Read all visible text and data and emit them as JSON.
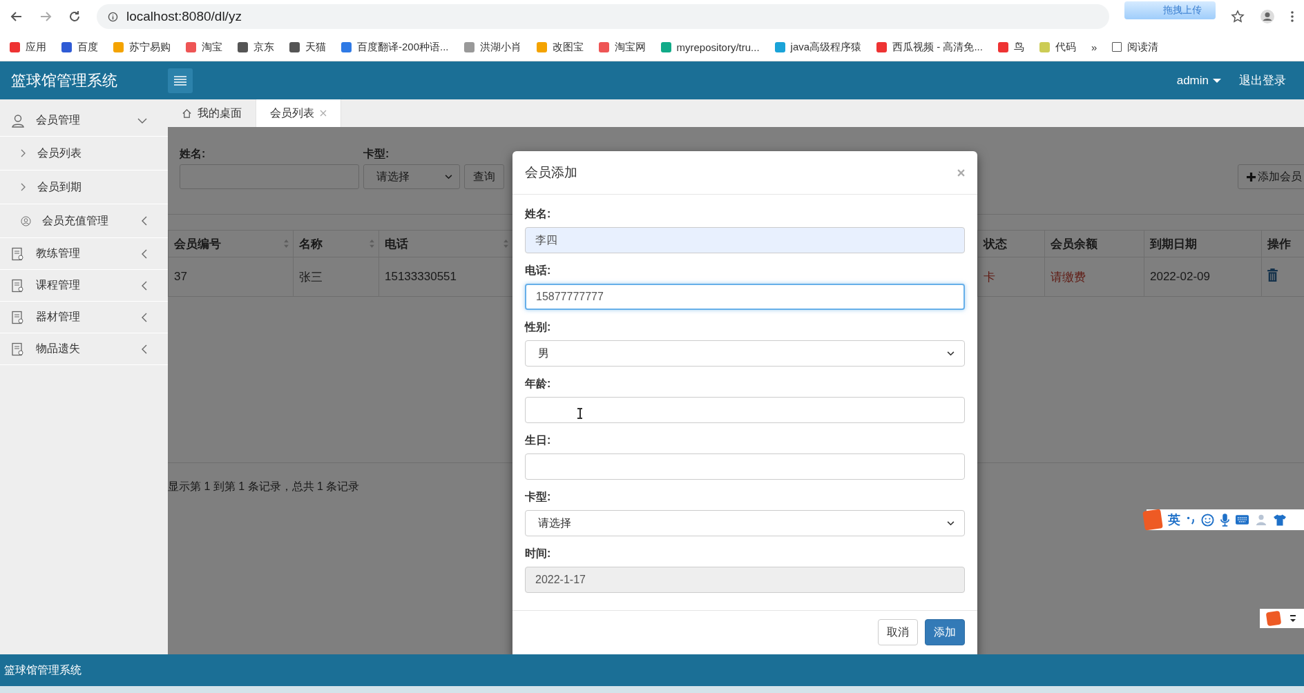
{
  "browser": {
    "url": "localhost:8080/dl/yz",
    "upload_widget": "拖拽上传",
    "bookmarks": [
      "应用",
      "百度",
      "苏宁易购",
      "淘宝",
      "京东",
      "天猫",
      "百度翻译-200种语...",
      "洪湖小肖",
      "改图宝",
      "淘宝网",
      "myrepository/tru...",
      "java高级程序猿",
      "西瓜视频 - 高清免...",
      "鸟",
      "代码"
    ],
    "more": "»",
    "reading_list": "阅读清"
  },
  "app": {
    "title": "篮球馆管理系统",
    "user": "admin",
    "logout": "退出登录"
  },
  "sidebar": {
    "items": [
      {
        "label": "会员管理",
        "expanded": true,
        "children": [
          {
            "label": "会员列表",
            "kind": "link"
          },
          {
            "label": "会员到期",
            "kind": "link"
          },
          {
            "label": "会员充值管理",
            "kind": "group",
            "expanded": false
          }
        ]
      },
      {
        "label": "教练管理",
        "expanded": false
      },
      {
        "label": "课程管理",
        "expanded": false
      },
      {
        "label": "器材管理",
        "expanded": false
      },
      {
        "label": "物品遗失",
        "expanded": false
      }
    ]
  },
  "tabs": [
    {
      "label": "我的桌面",
      "selected": false,
      "closable": false
    },
    {
      "label": "会员列表",
      "selected": true,
      "closable": true
    }
  ],
  "search": {
    "name_label": "姓名:",
    "card_label": "卡型:",
    "card_select": "请选择",
    "query_button": "查询",
    "add_button": "添加会员"
  },
  "table": {
    "columns": [
      {
        "label": "会员编号",
        "sortable": true
      },
      {
        "label": "名称",
        "sortable": true
      },
      {
        "label": "电话",
        "sortable": true
      },
      {
        "label": "状态",
        "sortable": false
      },
      {
        "label": "会员余额",
        "sortable": false
      },
      {
        "label": "到期日期",
        "sortable": false
      },
      {
        "label": "操作",
        "sortable": false
      }
    ],
    "rows": [
      {
        "cells": [
          {
            "text": "37",
            "alert": false
          },
          {
            "text": "张三",
            "alert": false
          },
          {
            "text": "15133330551",
            "alert": false
          },
          {
            "text": "卡",
            "alert": true
          },
          {
            "text": "请缴费",
            "alert": true
          },
          {
            "text": "2022-02-09",
            "alert": false
          }
        ]
      }
    ]
  },
  "pagination": "显示第 1 到第 1 条记录，总共 1 条记录",
  "modal": {
    "title": "会员添加",
    "fields": [
      {
        "label": "姓名:",
        "kind": "text",
        "value": "李四",
        "autofilled": true,
        "focused": false,
        "disabled": false
      },
      {
        "label": "电话:",
        "kind": "text",
        "value": "15877777777",
        "autofilled": false,
        "focused": true,
        "disabled": false
      },
      {
        "label": "性别:",
        "kind": "select",
        "value": "男",
        "autofilled": false,
        "focused": false,
        "disabled": false
      },
      {
        "label": "年龄:",
        "kind": "text",
        "autofilled": false,
        "focused": false,
        "disabled": false
      },
      {
        "label": "生日:",
        "kind": "text",
        "autofilled": false,
        "focused": false,
        "disabled": false
      },
      {
        "label": "卡型:",
        "kind": "select",
        "value": "请选择",
        "autofilled": false,
        "focused": false,
        "disabled": false
      },
      {
        "label": "时间:",
        "kind": "text",
        "value": "2022-1-17",
        "autofilled": false,
        "focused": false,
        "disabled": true
      }
    ],
    "buttons": [
      {
        "label": "取消",
        "kind": "default"
      },
      {
        "label": "添加",
        "kind": "primary"
      }
    ]
  },
  "ime": {
    "mode": "英"
  },
  "footer": "篮球馆管理系统"
}
